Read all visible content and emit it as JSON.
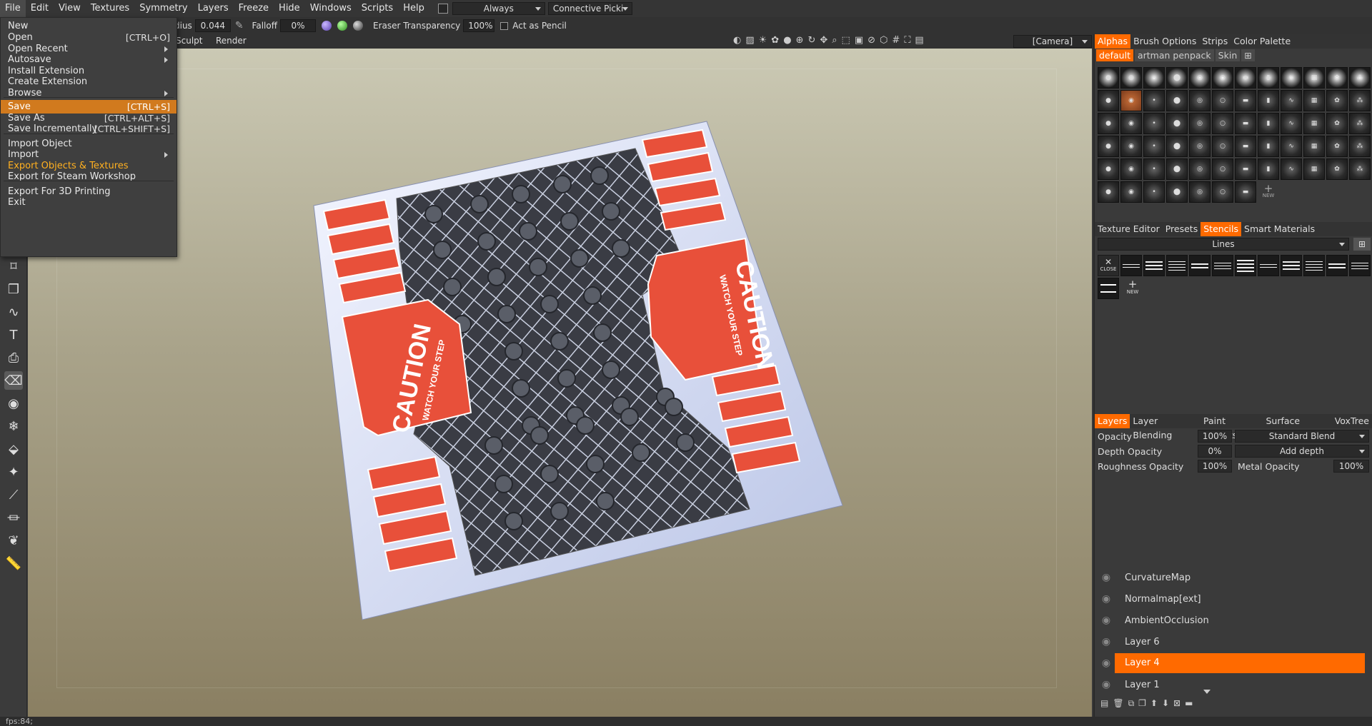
{
  "menubar": {
    "items": [
      "File",
      "Edit",
      "View",
      "Textures",
      "Symmetry",
      "Layers",
      "Freeze",
      "Hide",
      "Windows",
      "Scripts",
      "Help"
    ],
    "always_label": "Always",
    "picking_label": "Connective Picki"
  },
  "toolbar": {
    "radius_label": "dius",
    "radius_value": "0.044",
    "falloff_label": "Falloff",
    "falloff_value": "0%",
    "eraser_label": "Eraser Transparency",
    "eraser_value": "100%",
    "act_pencil_label": "Act as Pencil",
    "camera_label": "[Camera]"
  },
  "room_tabs": [
    "Sculpt",
    "Render"
  ],
  "file_menu": {
    "items": [
      {
        "label": "New",
        "shortcut": "",
        "submenu": false
      },
      {
        "label": "Open",
        "shortcut": "[CTRL+O]",
        "submenu": false
      },
      {
        "label": "Open Recent",
        "shortcut": "",
        "submenu": true
      },
      {
        "label": "Autosave",
        "shortcut": "",
        "submenu": true
      },
      {
        "label": "Install Extension",
        "shortcut": "",
        "submenu": false
      },
      {
        "label": "Create Extension",
        "shortcut": "",
        "submenu": false
      },
      {
        "label": "Browse",
        "shortcut": "",
        "submenu": true
      },
      {
        "label": "Save",
        "shortcut": "[CTRL+S]",
        "submenu": false,
        "highlighted": true
      },
      {
        "label": "Save As",
        "shortcut": "[CTRL+ALT+S]",
        "submenu": false
      },
      {
        "label": "Save Incrementally",
        "shortcut": "[CTRL+SHIFT+S]",
        "submenu": false
      },
      {
        "label": "Import Object",
        "shortcut": "",
        "submenu": false
      },
      {
        "label": "Import",
        "shortcut": "",
        "submenu": true
      },
      {
        "label": "Export Objects & Textures",
        "shortcut": "",
        "submenu": false,
        "accent": true
      },
      {
        "label": "Export for Steam Workshop",
        "shortcut": "",
        "submenu": false
      },
      {
        "label": "Export For 3D Printing",
        "shortcut": "",
        "submenu": false
      },
      {
        "label": "Exit",
        "shortcut": "",
        "submenu": false
      }
    ]
  },
  "viewport": {
    "caution_text": "CAUTION",
    "watch_text": "WATCH YOUR STEP"
  },
  "alphas_panel": {
    "tabs": [
      "Alphas",
      "Brush Options",
      "Strips",
      "Color Palette"
    ],
    "subtabs": [
      "default",
      "artman penpack",
      "Skin"
    ],
    "new_label": "NEW"
  },
  "stencils_panel": {
    "tabs": [
      "Texture Editor",
      "Presets",
      "Stencils",
      "Smart Materials"
    ],
    "dropdown": "Lines",
    "close_label": "CLOSE",
    "new_label": "NEW"
  },
  "layers_panel": {
    "tabs": [
      "Layers",
      "Layer Blending",
      "Paint Objects",
      "Surface Materi",
      "VoxTree"
    ],
    "opacity_label": "Opacity",
    "opacity_value": "100%",
    "blend_mode": "Standard Blend",
    "depth_opacity_label": "Depth Opacity",
    "depth_opacity_value": "0%",
    "depth_mode": "Add depth",
    "roughness_label": "Roughness Opacity",
    "roughness_value": "100%",
    "metal_label": "Metal Opacity",
    "metal_value": "100%",
    "layers": [
      "CurvatureMap",
      "Normalmap[ext]",
      "AmbientOcclusion",
      "Layer 6",
      "Layer 4",
      "Layer 1"
    ],
    "selected_layer": "Layer 4"
  },
  "status": {
    "fps": "fps:84;"
  },
  "colors": {
    "accent": "#ff6a00",
    "menu_highlight": "#d17a1e",
    "caution_red": "#e8503a"
  }
}
